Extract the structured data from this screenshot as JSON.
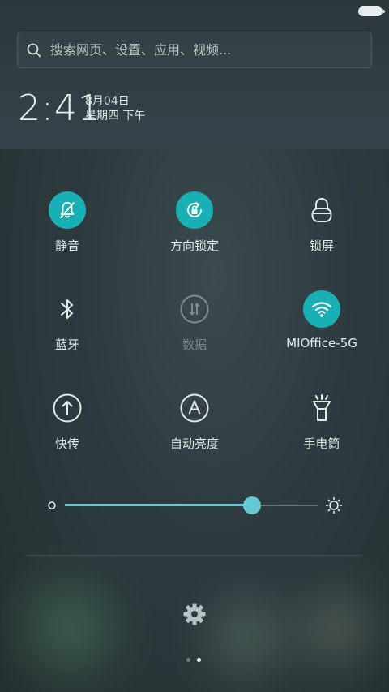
{
  "search": {
    "placeholder": "搜索网页、设置、应用、视频..."
  },
  "clock": {
    "time": "2:41",
    "date": "8月04日",
    "weekday": "星期四 下午"
  },
  "tiles": [
    {
      "label": "静音",
      "icon": "bell-muted-icon",
      "active": true
    },
    {
      "label": "方向锁定",
      "icon": "rotation-lock-icon",
      "active": true
    },
    {
      "label": "锁屏",
      "icon": "lock-icon",
      "active": false
    },
    {
      "label": "蓝牙",
      "icon": "bluetooth-icon",
      "active": false
    },
    {
      "label": "数据",
      "icon": "mobile-data-icon",
      "active": false,
      "disabled": true
    },
    {
      "label": "MIOffice-5G",
      "icon": "wifi-icon",
      "active": true
    },
    {
      "label": "快传",
      "icon": "quick-transfer-icon",
      "active": false
    },
    {
      "label": "自动亮度",
      "icon": "auto-brightness-icon",
      "active": false
    },
    {
      "label": "手电筒",
      "icon": "flashlight-icon",
      "active": false
    }
  ],
  "brightness": {
    "level": 0.74
  },
  "pager": {
    "pages": 2,
    "current": 2
  },
  "colors": {
    "accent": "#19b0b5",
    "slider": "#64c9d0"
  }
}
